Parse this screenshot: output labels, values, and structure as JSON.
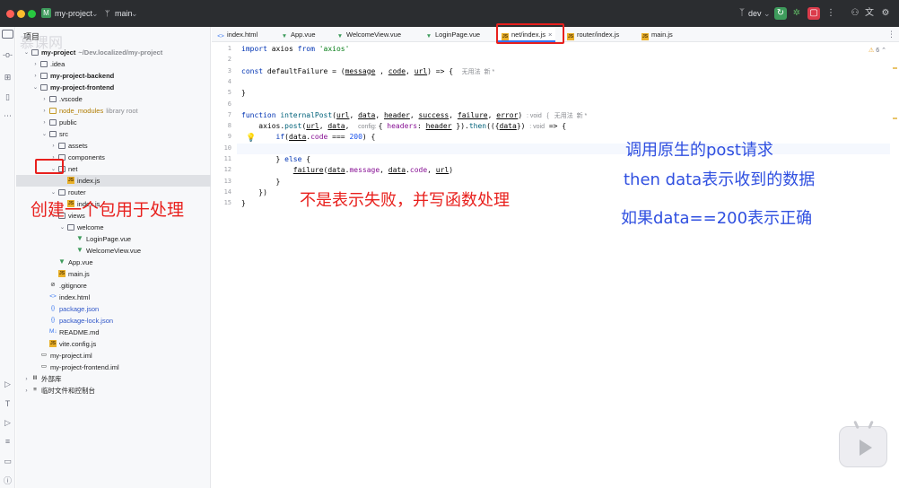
{
  "titlebar": {
    "project_badge": "M",
    "project_name": "my-project",
    "branch_icon": "branch-icon",
    "branch": "main",
    "run_config": "dev",
    "icons": [
      "run-icon",
      "debug-icon",
      "stop-icon",
      "more-icon",
      "user-icon",
      "translate-icon",
      "settings-icon"
    ]
  },
  "project_panel": {
    "header": "项目",
    "watermark": "慕课网",
    "tree": [
      {
        "label": "my-project",
        "hint": "~/Dev.localized/my-project",
        "indent": 0,
        "arrow": "v",
        "icon": "folder",
        "bold": true
      },
      {
        "label": ".idea",
        "hint": "",
        "indent": 1,
        "arrow": ">",
        "icon": "folder"
      },
      {
        "label": "my-project-backend",
        "hint": "",
        "indent": 1,
        "arrow": ">",
        "icon": "folder",
        "bold": true
      },
      {
        "label": "my-project-frontend",
        "hint": "",
        "indent": 1,
        "arrow": "v",
        "icon": "folder",
        "bold": true
      },
      {
        "label": ".vscode",
        "hint": "",
        "indent": 2,
        "arrow": ">",
        "icon": "folder"
      },
      {
        "label": "node_modules",
        "hint": "library root",
        "indent": 2,
        "arrow": ">",
        "icon": "folder-lib"
      },
      {
        "label": "public",
        "hint": "",
        "indent": 2,
        "arrow": ">",
        "icon": "folder"
      },
      {
        "label": "src",
        "hint": "",
        "indent": 2,
        "arrow": "v",
        "icon": "folder"
      },
      {
        "label": "assets",
        "hint": "",
        "indent": 3,
        "arrow": ">",
        "icon": "folder"
      },
      {
        "label": "components",
        "hint": "",
        "indent": 3,
        "arrow": ">",
        "icon": "folder"
      },
      {
        "label": "net",
        "hint": "",
        "indent": 3,
        "arrow": "v",
        "icon": "folder"
      },
      {
        "label": "index.js",
        "hint": "",
        "indent": 4,
        "arrow": "",
        "icon": "js",
        "selected": true
      },
      {
        "label": "router",
        "hint": "",
        "indent": 3,
        "arrow": "v",
        "icon": "folder"
      },
      {
        "label": "index.js",
        "hint": "",
        "indent": 4,
        "arrow": "",
        "icon": "js"
      },
      {
        "label": "views",
        "hint": "",
        "indent": 3,
        "arrow": "v",
        "icon": "folder"
      },
      {
        "label": "welcome",
        "hint": "",
        "indent": 4,
        "arrow": "v",
        "icon": "folder"
      },
      {
        "label": "LoginPage.vue",
        "hint": "",
        "indent": 5,
        "arrow": "",
        "icon": "vue"
      },
      {
        "label": "WelcomeView.vue",
        "hint": "",
        "indent": 5,
        "arrow": "",
        "icon": "vue"
      },
      {
        "label": "App.vue",
        "hint": "",
        "indent": 3,
        "arrow": "",
        "icon": "vue"
      },
      {
        "label": "main.js",
        "hint": "",
        "indent": 3,
        "arrow": "",
        "icon": "js"
      },
      {
        "label": ".gitignore",
        "hint": "",
        "indent": 2,
        "arrow": "",
        "icon": "ignore"
      },
      {
        "label": "index.html",
        "hint": "",
        "indent": 2,
        "arrow": "",
        "icon": "html"
      },
      {
        "label": "package.json",
        "hint": "",
        "indent": 2,
        "arrow": "",
        "icon": "json",
        "blue": true
      },
      {
        "label": "package-lock.json",
        "hint": "",
        "indent": 2,
        "arrow": "",
        "icon": "json",
        "blue": true
      },
      {
        "label": "README.md",
        "hint": "",
        "indent": 2,
        "arrow": "",
        "icon": "md"
      },
      {
        "label": "vite.config.js",
        "hint": "",
        "indent": 2,
        "arrow": "",
        "icon": "js"
      },
      {
        "label": "my-project.iml",
        "hint": "",
        "indent": 1,
        "arrow": "",
        "icon": "file"
      },
      {
        "label": "my-project-frontend.iml",
        "hint": "",
        "indent": 1,
        "arrow": "",
        "icon": "file"
      },
      {
        "label": "外部库",
        "hint": "",
        "indent": 0,
        "arrow": ">",
        "icon": "lib"
      },
      {
        "label": "临时文件和控制台",
        "hint": "",
        "indent": 0,
        "arrow": ">",
        "icon": "scratch"
      }
    ]
  },
  "tabs": [
    {
      "label": "index.html",
      "icon": "html"
    },
    {
      "label": "App.vue",
      "icon": "vue"
    },
    {
      "label": "WelcomeView.vue",
      "icon": "vue"
    },
    {
      "label": "LoginPage.vue",
      "icon": "vue"
    },
    {
      "label": "net/index.js",
      "icon": "js",
      "active": true
    },
    {
      "label": "router/index.js",
      "icon": "js"
    },
    {
      "label": "main.js",
      "icon": "js"
    }
  ],
  "editor": {
    "warning_count": "6",
    "line_numbers": [
      "1",
      "2",
      "3",
      "4",
      "5",
      "6",
      "7",
      "8",
      "9",
      "10",
      "11",
      "12",
      "13",
      "14",
      "15"
    ],
    "lines": [
      [
        [
          "kw",
          "import "
        ],
        [
          "",
          "axios "
        ],
        [
          "kw",
          "from "
        ],
        [
          "str",
          "'axios'"
        ]
      ],
      [],
      [
        [
          "kw",
          "const "
        ],
        [
          "",
          "defaultFailure = ("
        ],
        [
          "param",
          "message"
        ],
        [
          "",
          " , "
        ],
        [
          "param",
          "code"
        ],
        [
          "",
          ", "
        ],
        [
          "param",
          "url"
        ],
        [
          "",
          ") => {  "
        ],
        [
          "inlay",
          "无用法  新 *"
        ]
      ],
      [],
      [
        [
          "",
          "}"
        ]
      ],
      [],
      [
        [
          "kw",
          "function "
        ],
        [
          "fn",
          "internalPost"
        ],
        [
          "",
          "("
        ],
        [
          "param",
          "url"
        ],
        [
          "",
          ", "
        ],
        [
          "param",
          "data"
        ],
        [
          "",
          ", "
        ],
        [
          "param",
          "header"
        ],
        [
          "",
          ", "
        ],
        [
          "param",
          "success"
        ],
        [
          "",
          ", "
        ],
        [
          "param",
          "failure"
        ],
        [
          "",
          ", "
        ],
        [
          "param",
          "error"
        ],
        [
          "",
          ") "
        ],
        [
          "inlay",
          ": void   {   无用法  新 *"
        ]
      ],
      [
        [
          "",
          "    axios."
        ],
        [
          "fn",
          "post"
        ],
        [
          "",
          "("
        ],
        [
          "param",
          "url"
        ],
        [
          "",
          ", "
        ],
        [
          "param",
          "data"
        ],
        [
          "",
          ",  "
        ],
        [
          "inlay",
          "config: "
        ],
        [
          "",
          "{ "
        ],
        [
          "prop",
          "headers"
        ],
        [
          "",
          ": "
        ],
        [
          "param",
          "header"
        ],
        [
          "",
          " })."
        ],
        [
          "fn",
          "then"
        ],
        [
          "",
          "(({"
        ],
        [
          "param",
          "data"
        ],
        [
          "",
          "}) "
        ],
        [
          "inlay",
          ": void"
        ],
        [
          "",
          " => {"
        ]
      ],
      [
        [
          "",
          "        "
        ],
        [
          "kw",
          "if"
        ],
        [
          "",
          "("
        ],
        [
          "param",
          "data"
        ],
        [
          "",
          "."
        ],
        [
          "prop",
          "code"
        ],
        [
          "",
          " === "
        ],
        [
          "num",
          "200"
        ],
        [
          "",
          ") {"
        ]
      ],
      [],
      [
        [
          "",
          "        } "
        ],
        [
          "kw",
          "else "
        ],
        [
          "",
          "{"
        ]
      ],
      [
        [
          "",
          "            "
        ],
        [
          "param",
          "failure"
        ],
        [
          "",
          "("
        ],
        [
          "param",
          "data"
        ],
        [
          "",
          "."
        ],
        [
          "prop",
          "message"
        ],
        [
          "",
          ", "
        ],
        [
          "param",
          "data"
        ],
        [
          "",
          "."
        ],
        [
          "prop",
          "code"
        ],
        [
          "",
          ", "
        ],
        [
          "param",
          "url"
        ],
        [
          "",
          ")"
        ]
      ],
      [
        [
          "",
          "        }"
        ]
      ],
      [
        [
          "",
          "    })"
        ]
      ],
      [
        [
          "",
          "}"
        ]
      ]
    ]
  },
  "annotations": {
    "create_package": "创建一个包用于处理",
    "not_failure": "不是表示失败，并写函数处理",
    "call_post": "调用原生的post请求",
    "then_data": "then data表示收到的数据",
    "if_200": "如果data==200表示正确"
  },
  "colors": {
    "accent_red": "#e8201d",
    "annotation_blue": "#2f4fe0",
    "tab_active": "#3574f0"
  }
}
